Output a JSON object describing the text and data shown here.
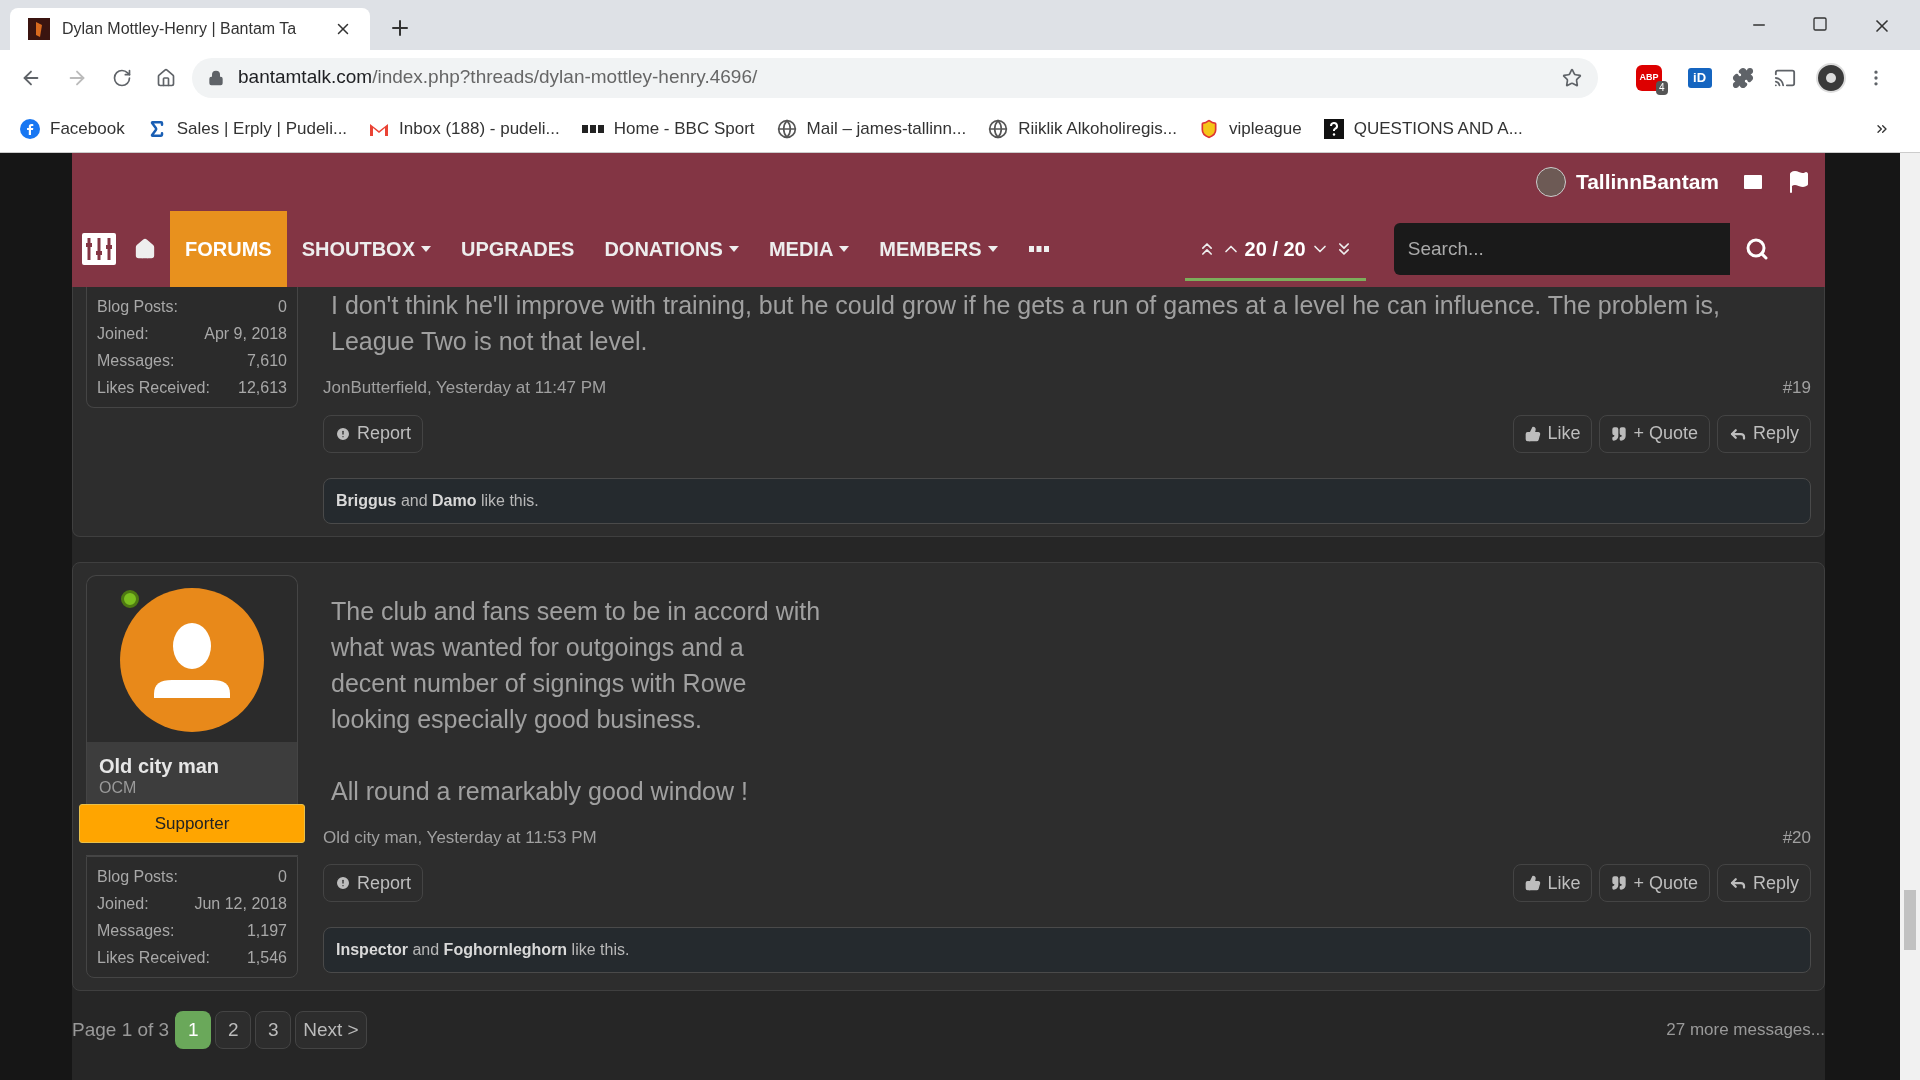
{
  "browser": {
    "tab_title": "Dylan Mottley-Henry | Bantam Ta",
    "url_domain": "bantamtalk.com",
    "url_path": "/index.php?threads/dylan-mottley-henry.4696/",
    "extensions": [
      {
        "kind": "abp",
        "label": "ABP",
        "badge": "4"
      },
      {
        "kind": "id",
        "label": "iD"
      },
      {
        "kind": "puzzle"
      },
      {
        "kind": "cast"
      },
      {
        "kind": "profile"
      }
    ],
    "bookmarks": [
      {
        "kind": "facebook",
        "label": "Facebook"
      },
      {
        "kind": "sigma",
        "label": "Sales | Erply | Pudeli..."
      },
      {
        "kind": "gmail",
        "label": "Inbox (188) - pudeli..."
      },
      {
        "kind": "bbc",
        "label": "Home - BBC Sport"
      },
      {
        "kind": "globe",
        "label": "Mail – james-tallinn..."
      },
      {
        "kind": "globe",
        "label": "Riiklik Alkoholiregis..."
      },
      {
        "kind": "shield",
        "label": "vipleague"
      },
      {
        "kind": "question",
        "label": "QUESTIONS AND A..."
      }
    ]
  },
  "header": {
    "username": "TallinnBantam"
  },
  "nav": {
    "items": [
      {
        "kind": "home"
      },
      {
        "kind": "text",
        "label": "FORUMS",
        "selected": true,
        "dropdown": false
      },
      {
        "kind": "text",
        "label": "SHOUTBOX",
        "selected": false,
        "dropdown": true
      },
      {
        "kind": "text",
        "label": "UPGRADES",
        "selected": false,
        "dropdown": false
      },
      {
        "kind": "text",
        "label": "DONATIONS",
        "selected": false,
        "dropdown": true
      },
      {
        "kind": "text",
        "label": "MEDIA",
        "selected": false,
        "dropdown": true
      },
      {
        "kind": "text",
        "label": "MEMBERS",
        "selected": false,
        "dropdown": true
      },
      {
        "kind": "more"
      }
    ],
    "counter": "20 / 20",
    "progress": {
      "level": 1
    },
    "search": {
      "placeholder": "Search..."
    }
  },
  "posts": [
    {
      "user": {
        "stats": [
          {
            "label": "Blog Posts:",
            "value": "0"
          },
          {
            "label": "Joined:",
            "value": "Apr 9, 2018"
          },
          {
            "label": "Messages:",
            "value": "7,610"
          },
          {
            "label": "Likes Received:",
            "value": "12,613"
          }
        ]
      },
      "paragraphs": [
        "I don't think he'll improve with training, but he could grow if he gets a run of games at a level he can influence. The problem is, League Two is not that level."
      ],
      "byline": "JonButterfield, Yesterday at 11:47 PM",
      "number": "#19",
      "report": "Report",
      "actions": [
        "Like",
        "+ Quote",
        "Reply"
      ],
      "likes": "**Briggus** and **Damo** like this."
    },
    {
      "user": {
        "online": true,
        "name": "Old city man",
        "title": "OCM",
        "banner": "Supporter",
        "stats": [
          {
            "label": "Blog Posts:",
            "value": "0"
          },
          {
            "label": "Joined:",
            "value": "Jun 12, 2018"
          },
          {
            "label": "Messages:",
            "value": "1,197"
          },
          {
            "label": "Likes Received:",
            "value": "1,546"
          }
        ]
      },
      "paragraphs": [
        "The club and fans seem to be in accord with what was wanted for outgoings and a decent number of signings with Rowe looking especially good business.",
        "All round a remarkably good window !"
      ],
      "byline": "Old city man, Yesterday at 11:53 PM",
      "number": "#20",
      "report": "Report",
      "actions": [
        "Like",
        "+ Quote",
        "Reply"
      ],
      "likes": "**Inspector** and **Foghornleghorn** like this."
    }
  ],
  "pagination": {
    "label": "Page 1 of 3",
    "pages": [
      {
        "label": "1",
        "selected": true
      },
      {
        "label": "2",
        "selected": false
      },
      {
        "label": "3",
        "selected": false
      }
    ],
    "next": "Next >",
    "more": "27 more messages..."
  }
}
